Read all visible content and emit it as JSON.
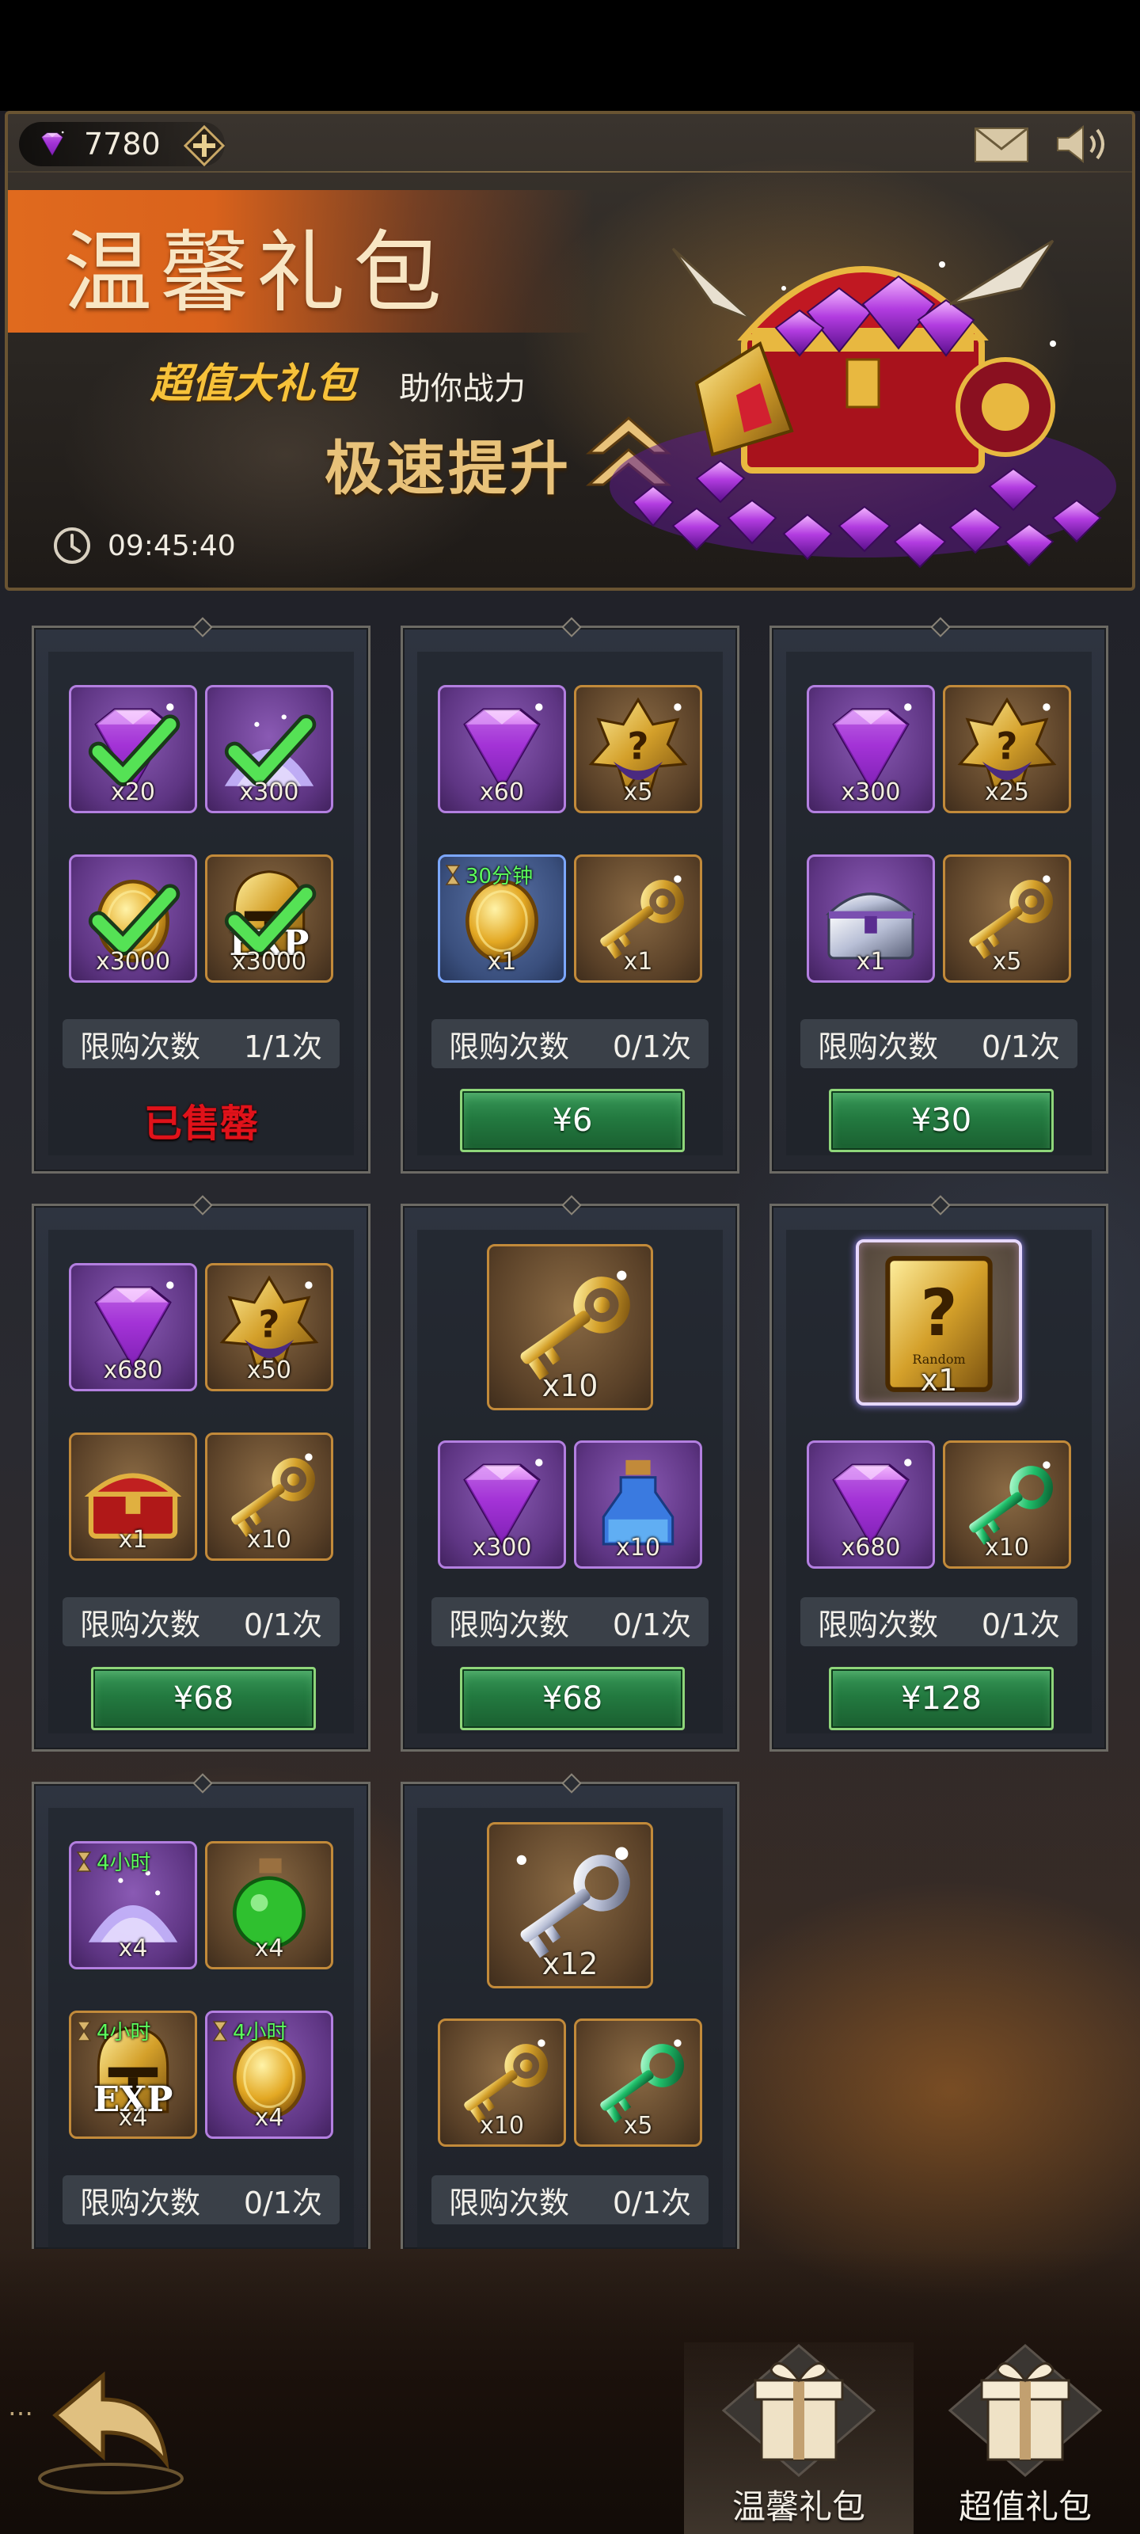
{
  "currency": {
    "gems": "7780"
  },
  "banner": {
    "title": "温馨礼包",
    "subtitle_gold": "超值大礼包",
    "subtitle_white": "助你战力",
    "speed_text": "极速提升",
    "timer": "09:45:40"
  },
  "packs": [
    {
      "items": [
        {
          "icon": "diamond-icon",
          "qty": "x20",
          "claimed": true
        },
        {
          "icon": "dust-icon",
          "qty": "x300",
          "claimed": true
        },
        {
          "icon": "gold-coin-icon",
          "qty": "x3000",
          "claimed": true
        },
        {
          "icon": "exp-helmet-icon",
          "qty": "x3000",
          "claimed": true,
          "exp": "EXP"
        }
      ],
      "limit_label": "限购次数",
      "limit_value": "1/1次",
      "status": "已售罄"
    },
    {
      "items": [
        {
          "icon": "diamond-icon",
          "qty": "x60"
        },
        {
          "icon": "mystery-emblem-icon",
          "qty": "x5"
        },
        {
          "icon": "gold-coin-icon",
          "qty": "x1",
          "tag": "30分钟"
        },
        {
          "icon": "gold-key-icon",
          "qty": "x1"
        }
      ],
      "limit_label": "限购次数",
      "limit_value": "0/1次",
      "price": "¥6"
    },
    {
      "items": [
        {
          "icon": "diamond-icon",
          "qty": "x300"
        },
        {
          "icon": "mystery-emblem-icon",
          "qty": "x25"
        },
        {
          "icon": "silver-chest-icon",
          "qty": "x1"
        },
        {
          "icon": "gold-key-icon",
          "qty": "x5"
        }
      ],
      "limit_label": "限购次数",
      "limit_value": "0/1次",
      "price": "¥30"
    },
    {
      "items": [
        {
          "icon": "diamond-icon",
          "qty": "x680"
        },
        {
          "icon": "mystery-emblem-icon",
          "qty": "x50"
        },
        {
          "icon": "red-chest-icon",
          "qty": "x1"
        },
        {
          "icon": "gold-key-icon",
          "qty": "x10"
        }
      ],
      "limit_label": "限购次数",
      "limit_value": "0/1次",
      "price": "¥68"
    },
    {
      "featured": {
        "icon": "gold-key-icon",
        "qty": "x10"
      },
      "items": [
        {
          "icon": "diamond-icon",
          "qty": "x300"
        },
        {
          "icon": "blue-potion-icon",
          "qty": "x10"
        }
      ],
      "limit_label": "限购次数",
      "limit_value": "0/1次",
      "price": "¥68"
    },
    {
      "featured": {
        "icon": "random-card-icon",
        "qty": "x1",
        "card_text": "Random"
      },
      "items": [
        {
          "icon": "diamond-icon",
          "qty": "x680"
        },
        {
          "icon": "emerald-key-icon",
          "qty": "x10"
        }
      ],
      "limit_label": "限购次数",
      "limit_value": "0/1次",
      "price": "¥128"
    },
    {
      "items": [
        {
          "icon": "dust-icon",
          "qty": "x4",
          "tag": "4小时"
        },
        {
          "icon": "green-potion-icon",
          "qty": "x4"
        },
        {
          "icon": "exp-helmet-icon",
          "qty": "x4",
          "tag": "4小时",
          "exp": "EXP"
        },
        {
          "icon": "gold-coin-icon",
          "qty": "x4",
          "tag": "4小时"
        }
      ],
      "limit_label": "限购次数",
      "limit_value": "0/1次"
    },
    {
      "featured": {
        "icon": "silver-key-icon",
        "qty": "x12"
      },
      "items": [
        {
          "icon": "gold-key-icon",
          "qty": "x10"
        },
        {
          "icon": "emerald-key-icon",
          "qty": "x5"
        }
      ],
      "limit_label": "限购次数",
      "limit_value": "0/1次"
    }
  ],
  "nav": {
    "tab_warm": "温馨礼包",
    "tab_value": "超值礼包"
  },
  "colors": {
    "accent_orange": "#e06a1e",
    "gold": "#f7c23a",
    "price_green": "#237a40",
    "sold_out_red": "#e0121a",
    "tag_green": "#5cff5c"
  }
}
